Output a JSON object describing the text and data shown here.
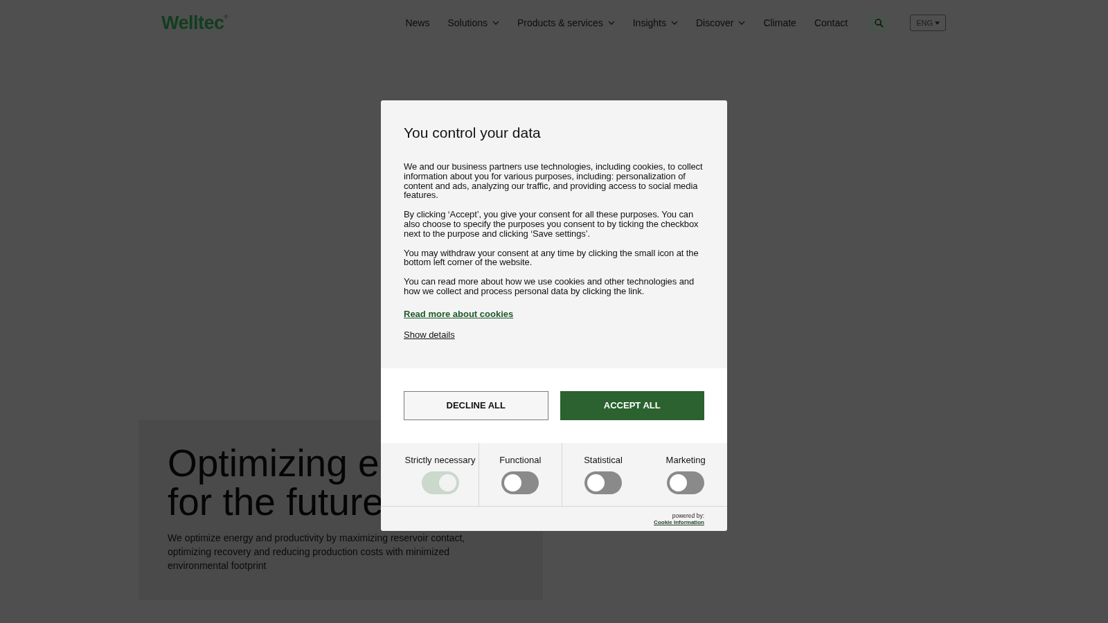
{
  "header": {
    "logo": "Welltec",
    "logo_mark": "®",
    "nav": [
      {
        "label": "News",
        "dropdown": false
      },
      {
        "label": "Solutions",
        "dropdown": true
      },
      {
        "label": "Products & services",
        "dropdown": true
      },
      {
        "label": "Insights",
        "dropdown": true
      },
      {
        "label": "Discover",
        "dropdown": true
      },
      {
        "label": "Climate",
        "dropdown": false
      },
      {
        "label": "Contact",
        "dropdown": false
      }
    ],
    "language": "ENG"
  },
  "hero": {
    "heading": [
      "Optimizing e",
      "for the future"
    ],
    "text": "We optimize energy and productivity by maximizing reservoir contact, optimizing recovery and reducing production costs with minimized environmental footprint"
  },
  "consent": {
    "title": "You control your data",
    "paragraphs": [
      "We and our business partners use technologies, including cookies, to collect information about you for various purposes, including: personalization of content and ads, analyzing our traffic, and providing access to social media features.",
      "By clicking ‘Accept’, you give your consent for all these purposes. You can also choose to specify the purposes you consent to by ticking the checkbox next to the purpose and clicking ‘Save settings’.",
      "You may withdraw your consent at any time by clicking the small icon at the bottom left corner of the website.",
      "You can read more about how we use cookies and other technologies and how we collect and process personal data by clicking the link."
    ],
    "read_more_link": "Read more about cookies",
    "details_link": "Show details",
    "buttons": [
      {
        "label": "DECLINE ALL",
        "kind": "secondary"
      },
      {
        "label": "ACCEPT ALL",
        "kind": "primary"
      }
    ],
    "categories": [
      {
        "label": "Strictly necessary",
        "checked": true,
        "disabled": true
      },
      {
        "label": "Functional",
        "checked": false,
        "disabled": false
      },
      {
        "label": "Statistical",
        "checked": false,
        "disabled": false
      },
      {
        "label": "Marketing",
        "checked": false,
        "disabled": false
      }
    ],
    "powered_by": "powered by:",
    "provider_link": "Cookie Information"
  }
}
